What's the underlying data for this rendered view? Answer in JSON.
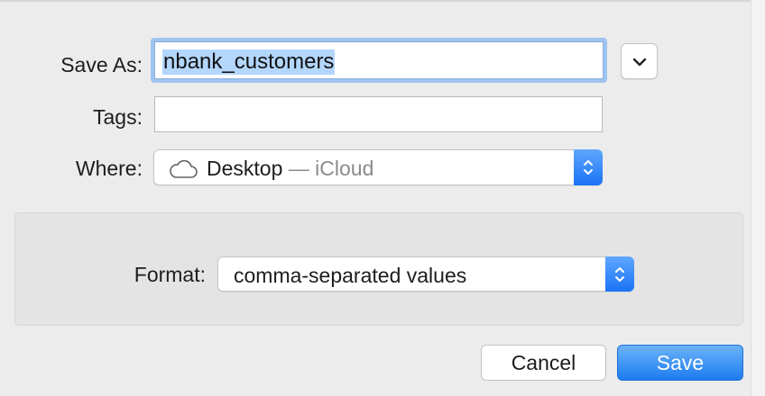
{
  "dialog": {
    "save_as": {
      "label": "Save As:",
      "value": "nbank_customers"
    },
    "tags": {
      "label": "Tags:",
      "value": ""
    },
    "where": {
      "label": "Where:",
      "location": "Desktop",
      "separator": "—",
      "service": "iCloud",
      "icon": "cloud-icon"
    },
    "format": {
      "label": "Format:",
      "selected": "comma-separated values"
    },
    "buttons": {
      "cancel": "Cancel",
      "save": "Save"
    },
    "colors": {
      "accent": "#1a73f5",
      "selection": "#b3d6fd",
      "focus_ring": "#9fc4ef"
    }
  }
}
